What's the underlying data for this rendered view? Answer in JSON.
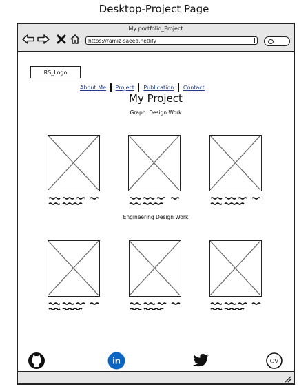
{
  "page_title": "Desktop-Project Page",
  "window": {
    "title": "My portfolio_Project",
    "url": "https://ramiz-saeed.netlify",
    "nav_icons": [
      "back-arrow-icon",
      "forward-arrow-icon",
      "close-x-icon",
      "home-icon"
    ]
  },
  "logo": {
    "label": "RS_Logo"
  },
  "nav": {
    "items": [
      {
        "label": "About Me"
      },
      {
        "label": "Project"
      },
      {
        "label": "Publication"
      },
      {
        "label": "Contact"
      }
    ]
  },
  "main": {
    "heading": "My Project",
    "section1": {
      "title": "Graph. Design Work"
    },
    "section2": {
      "title": "Engineering Design Work"
    }
  },
  "footer": {
    "icons": [
      "github-icon",
      "linkedin-icon",
      "twitter-icon",
      "cv-icon"
    ],
    "cv_label": "CV",
    "linkedin_label": "in",
    "linkedin_color": "#0a66c2"
  }
}
